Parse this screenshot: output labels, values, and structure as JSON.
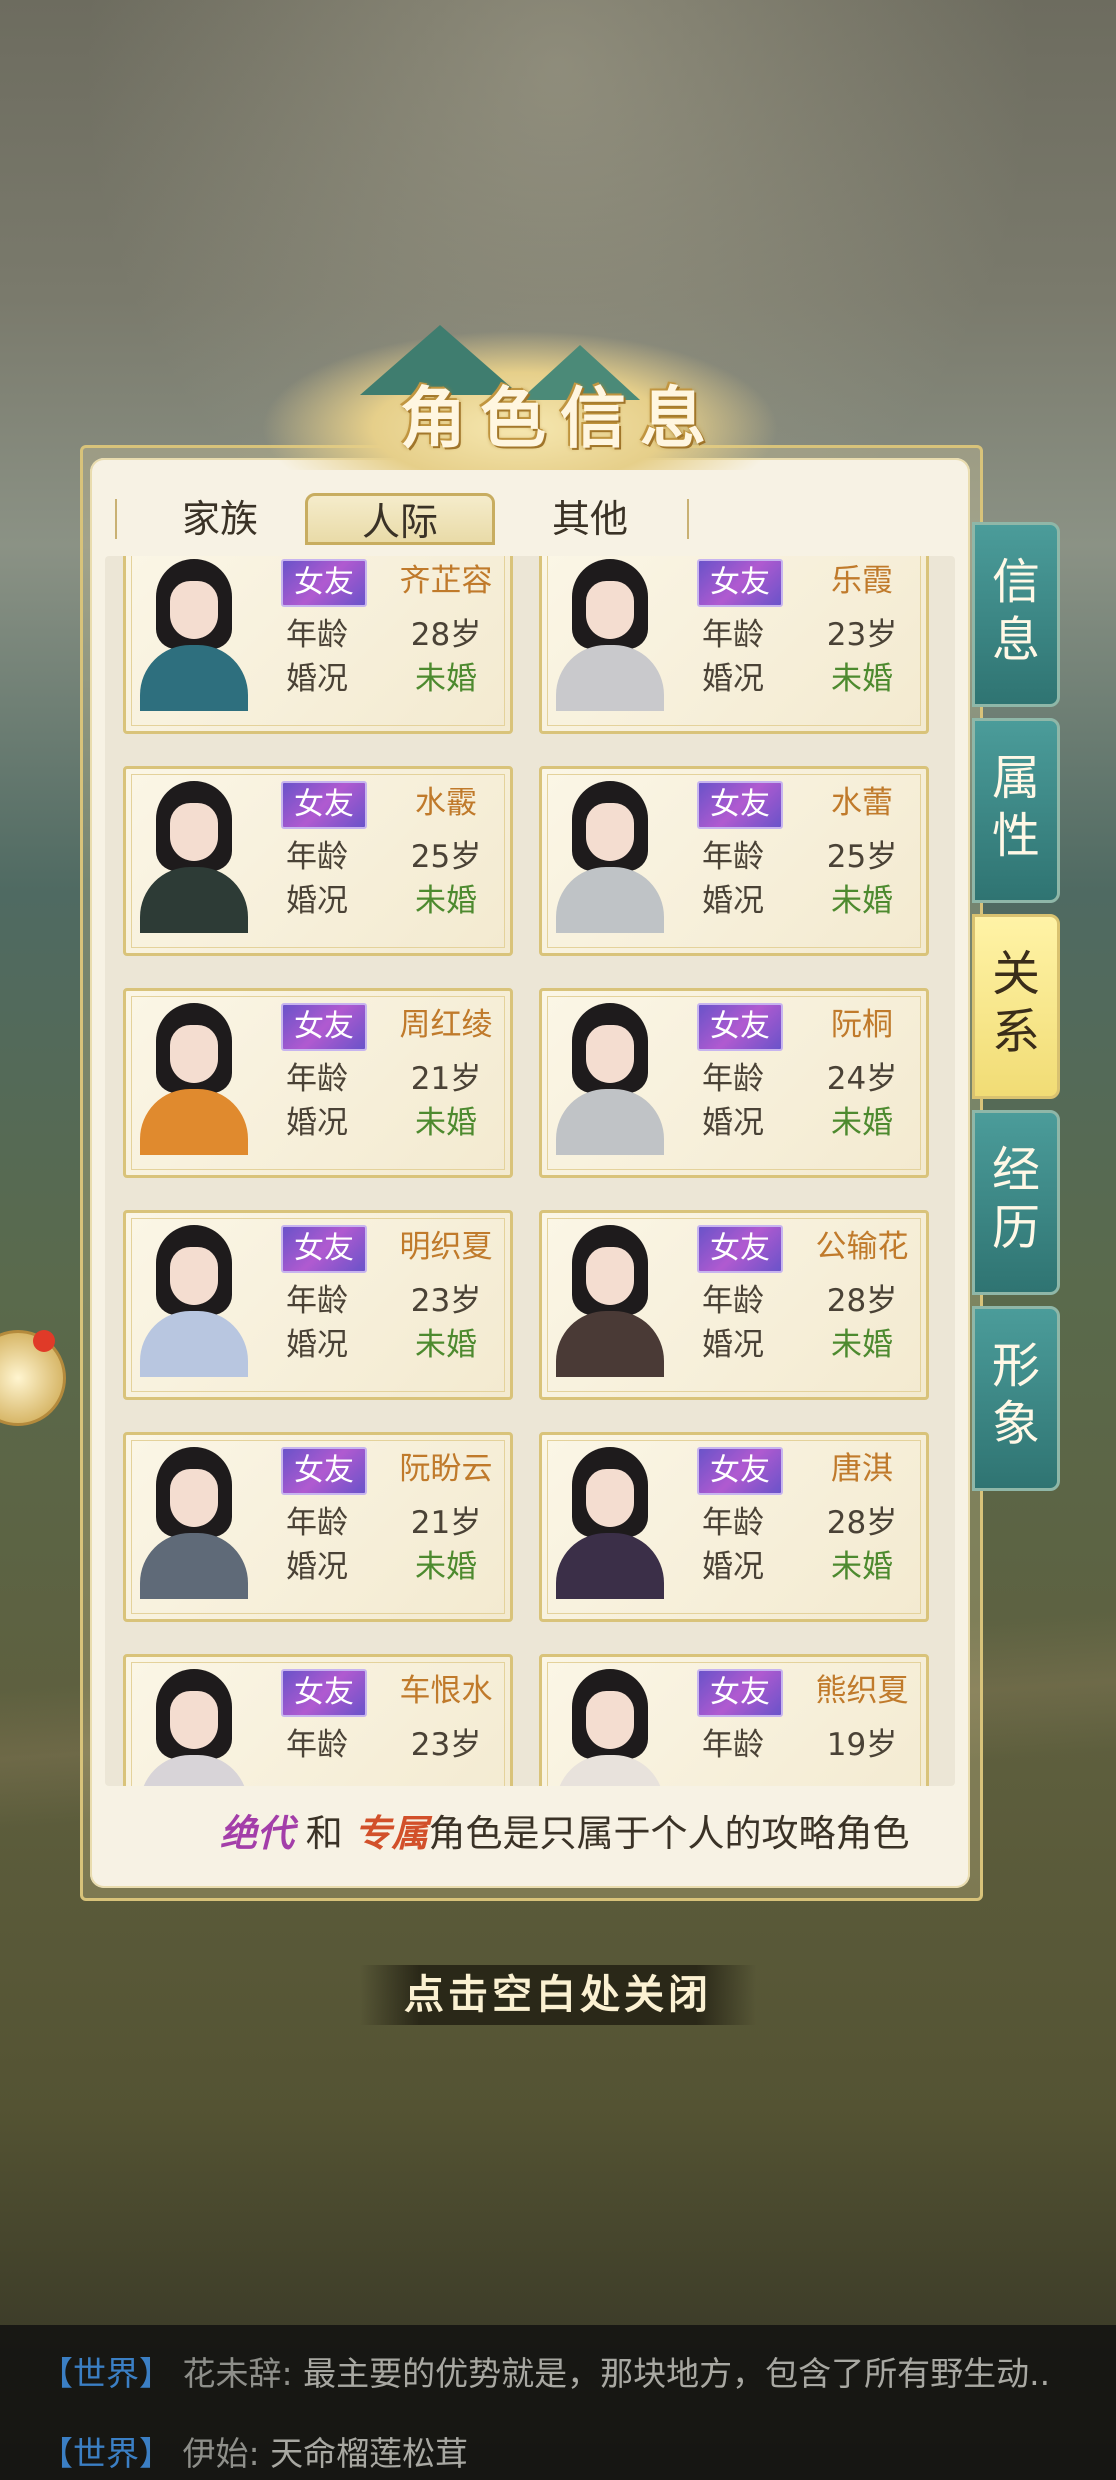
{
  "title": "角色信息",
  "tabs": [
    {
      "label": "家族",
      "active": false
    },
    {
      "label": "人际",
      "active": true
    },
    {
      "label": "其他",
      "active": false
    }
  ],
  "side_tabs": [
    {
      "label": "信息",
      "active": false
    },
    {
      "label": "属性",
      "active": false
    },
    {
      "label": "关系",
      "active": true
    },
    {
      "label": "经历",
      "active": false
    },
    {
      "label": "形象",
      "active": false
    }
  ],
  "labels": {
    "age": "年龄",
    "marital": "婚况"
  },
  "cards": [
    {
      "badge": "女友",
      "name": "齐芷容",
      "age": "28岁",
      "status": "未婚"
    },
    {
      "badge": "女友",
      "name": "乐霞",
      "age": "23岁",
      "status": "未婚"
    },
    {
      "badge": "女友",
      "name": "水霰",
      "age": "25岁",
      "status": "未婚"
    },
    {
      "badge": "女友",
      "name": "水蕾",
      "age": "25岁",
      "status": "未婚"
    },
    {
      "badge": "女友",
      "name": "周红绫",
      "age": "21岁",
      "status": "未婚"
    },
    {
      "badge": "女友",
      "name": "阮桐",
      "age": "24岁",
      "status": "未婚"
    },
    {
      "badge": "女友",
      "name": "明织夏",
      "age": "23岁",
      "status": "未婚"
    },
    {
      "badge": "女友",
      "name": "公输花",
      "age": "28岁",
      "status": "未婚"
    },
    {
      "badge": "女友",
      "name": "阮盼云",
      "age": "21岁",
      "status": "未婚"
    },
    {
      "badge": "女友",
      "name": "唐淇",
      "age": "28岁",
      "status": "未婚"
    },
    {
      "badge": "女友",
      "name": "车恨水",
      "age": "23岁",
      "status": ""
    },
    {
      "badge": "女友",
      "name": "熊织夏",
      "age": "19岁",
      "status": ""
    }
  ],
  "footnote": {
    "tag1": "绝代",
    "and": "和",
    "tag2": "专属",
    "text": "角色是只属于个人的攻略角色"
  },
  "close_hint": "点击空白处关闭",
  "chat": [
    {
      "channel": "【世界】",
      "user": "花未辞:",
      "message": "最主要的优势就是，那块地方，包含了所有野生动.."
    },
    {
      "channel": "【世界】",
      "user": "伊始:",
      "message": "天命榴莲松茸"
    }
  ],
  "colors": {
    "accent_teal": "#2f7472",
    "badge_purple": "#8a55cc",
    "name_orange": "#c07a2b",
    "single_green": "#4d8a2f",
    "active_gold": "#f1dc75"
  }
}
